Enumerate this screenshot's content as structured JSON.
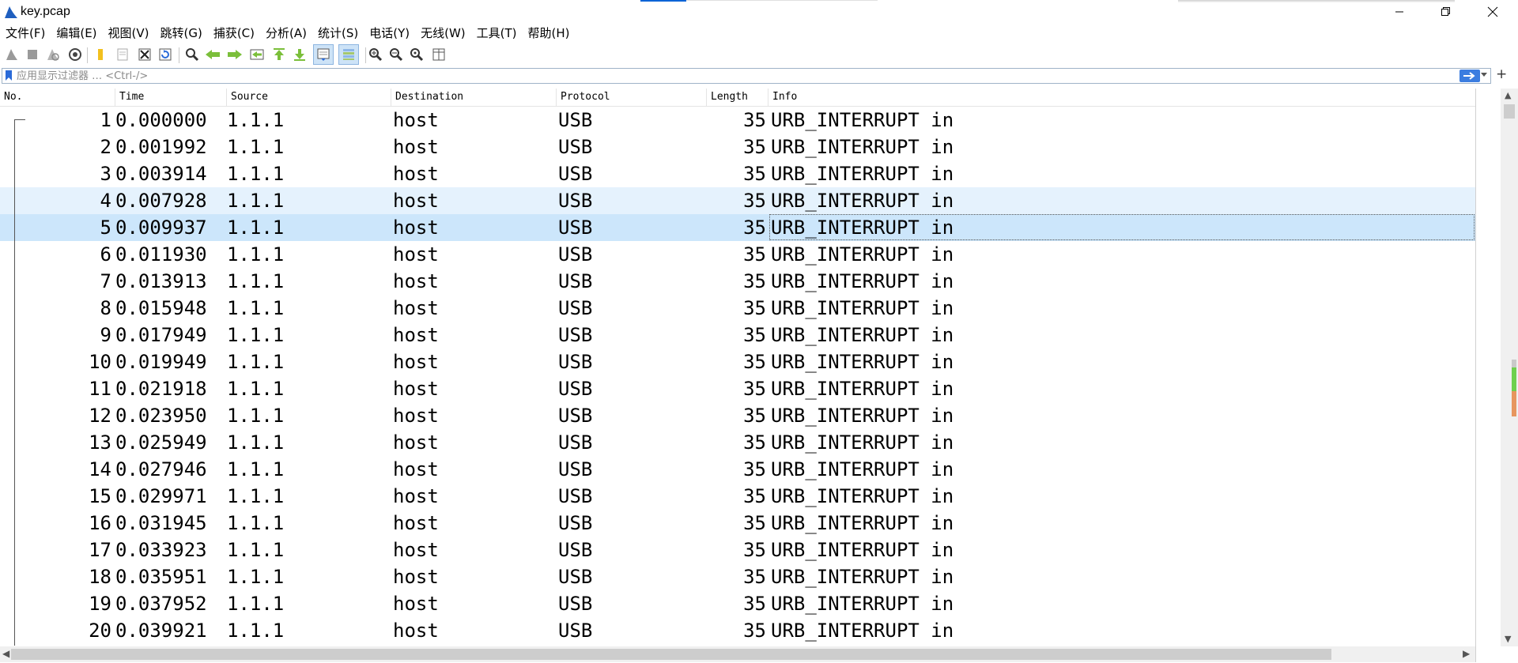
{
  "window": {
    "title": "key.pcap",
    "controls": [
      "minimize-icon",
      "restore-icon",
      "close-icon"
    ]
  },
  "menu": [
    {
      "label": "文件(F)"
    },
    {
      "label": "编辑(E)"
    },
    {
      "label": "视图(V)"
    },
    {
      "label": "跳转(G)"
    },
    {
      "label": "捕获(C)"
    },
    {
      "label": "分析(A)"
    },
    {
      "label": "统计(S)"
    },
    {
      "label": "电话(Y)"
    },
    {
      "label": "无线(W)"
    },
    {
      "label": "工具(T)"
    },
    {
      "label": "帮助(H)"
    }
  ],
  "toolbar": {
    "icons": [
      "start-capture-icon",
      "stop-capture-icon",
      "restart-capture-icon",
      "capture-options-icon",
      "open-file-icon",
      "save-file-icon",
      "close-file-icon",
      "reload-file-icon",
      "find-packet-icon",
      "go-back-icon",
      "go-forward-icon",
      "go-to-packet-icon",
      "go-first-icon",
      "go-last-icon",
      "autoscroll-icon",
      "colorize-icon",
      "zoom-in-icon",
      "zoom-out-icon",
      "normal-size-icon",
      "resize-columns-icon"
    ]
  },
  "filter": {
    "placeholder": "应用显示过滤器 … <Ctrl-/>",
    "value": "",
    "add_button": "+"
  },
  "columns": {
    "no": "No.",
    "time": "Time",
    "source": "Source",
    "destination": "Destination",
    "protocol": "Protocol",
    "length": "Length",
    "info": "Info"
  },
  "packets": [
    {
      "no": "1",
      "time": "0.000000",
      "source": "1.1.1",
      "destination": "host",
      "protocol": "USB",
      "length": "35",
      "info": "URB_INTERRUPT in",
      "state": "normal"
    },
    {
      "no": "2",
      "time": "0.001992",
      "source": "1.1.1",
      "destination": "host",
      "protocol": "USB",
      "length": "35",
      "info": "URB_INTERRUPT in",
      "state": "normal"
    },
    {
      "no": "3",
      "time": "0.003914",
      "source": "1.1.1",
      "destination": "host",
      "protocol": "USB",
      "length": "35",
      "info": "URB_INTERRUPT in",
      "state": "normal"
    },
    {
      "no": "4",
      "time": "0.007928",
      "source": "1.1.1",
      "destination": "host",
      "protocol": "USB",
      "length": "35",
      "info": "URB_INTERRUPT in",
      "state": "hover"
    },
    {
      "no": "5",
      "time": "0.009937",
      "source": "1.1.1",
      "destination": "host",
      "protocol": "USB",
      "length": "35",
      "info": "URB_INTERRUPT in",
      "state": "selected"
    },
    {
      "no": "6",
      "time": "0.011930",
      "source": "1.1.1",
      "destination": "host",
      "protocol": "USB",
      "length": "35",
      "info": "URB_INTERRUPT in",
      "state": "normal"
    },
    {
      "no": "7",
      "time": "0.013913",
      "source": "1.1.1",
      "destination": "host",
      "protocol": "USB",
      "length": "35",
      "info": "URB_INTERRUPT in",
      "state": "normal"
    },
    {
      "no": "8",
      "time": "0.015948",
      "source": "1.1.1",
      "destination": "host",
      "protocol": "USB",
      "length": "35",
      "info": "URB_INTERRUPT in",
      "state": "normal"
    },
    {
      "no": "9",
      "time": "0.017949",
      "source": "1.1.1",
      "destination": "host",
      "protocol": "USB",
      "length": "35",
      "info": "URB_INTERRUPT in",
      "state": "normal"
    },
    {
      "no": "10",
      "time": "0.019949",
      "source": "1.1.1",
      "destination": "host",
      "protocol": "USB",
      "length": "35",
      "info": "URB_INTERRUPT in",
      "state": "normal"
    },
    {
      "no": "11",
      "time": "0.021918",
      "source": "1.1.1",
      "destination": "host",
      "protocol": "USB",
      "length": "35",
      "info": "URB_INTERRUPT in",
      "state": "normal"
    },
    {
      "no": "12",
      "time": "0.023950",
      "source": "1.1.1",
      "destination": "host",
      "protocol": "USB",
      "length": "35",
      "info": "URB_INTERRUPT in",
      "state": "normal"
    },
    {
      "no": "13",
      "time": "0.025949",
      "source": "1.1.1",
      "destination": "host",
      "protocol": "USB",
      "length": "35",
      "info": "URB_INTERRUPT in",
      "state": "normal"
    },
    {
      "no": "14",
      "time": "0.027946",
      "source": "1.1.1",
      "destination": "host",
      "protocol": "USB",
      "length": "35",
      "info": "URB_INTERRUPT in",
      "state": "normal"
    },
    {
      "no": "15",
      "time": "0.029971",
      "source": "1.1.1",
      "destination": "host",
      "protocol": "USB",
      "length": "35",
      "info": "URB_INTERRUPT in",
      "state": "normal"
    },
    {
      "no": "16",
      "time": "0.031945",
      "source": "1.1.1",
      "destination": "host",
      "protocol": "USB",
      "length": "35",
      "info": "URB_INTERRUPT in",
      "state": "normal"
    },
    {
      "no": "17",
      "time": "0.033923",
      "source": "1.1.1",
      "destination": "host",
      "protocol": "USB",
      "length": "35",
      "info": "URB_INTERRUPT in",
      "state": "normal"
    },
    {
      "no": "18",
      "time": "0.035951",
      "source": "1.1.1",
      "destination": "host",
      "protocol": "USB",
      "length": "35",
      "info": "URB_INTERRUPT in",
      "state": "normal"
    },
    {
      "no": "19",
      "time": "0.037952",
      "source": "1.1.1",
      "destination": "host",
      "protocol": "USB",
      "length": "35",
      "info": "URB_INTERRUPT in",
      "state": "normal"
    },
    {
      "no": "20",
      "time": "0.039921",
      "source": "1.1.1",
      "destination": "host",
      "protocol": "USB",
      "length": "35",
      "info": "URB_INTERRUPT in",
      "state": "normal"
    }
  ],
  "colors": {
    "selected_row": "#cce6fb",
    "hover_row": "#e5f2fd",
    "accent": "#0a64d6"
  }
}
